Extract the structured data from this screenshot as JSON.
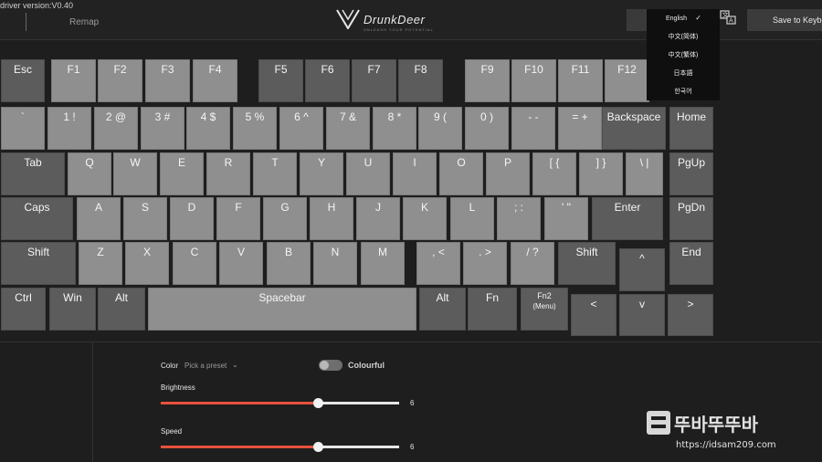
{
  "header": {
    "version": "driver version:V0.40",
    "remap_label": "Remap",
    "logo_text": "DrunkDeer",
    "tagline": "UNLEASH YOUR POTENTIAL",
    "save_label": "Save to Keyboard"
  },
  "language_menu": {
    "selected": "English",
    "items": [
      "English",
      "中文(简体)",
      "中文(繁体)",
      "日本語",
      "한국어"
    ]
  },
  "keyboard": {
    "rows": [
      [
        {
          "name": "key-esc",
          "label": "Esc",
          "tone": "dark"
        },
        {
          "name": "key-f1",
          "label": "F1",
          "tone": "light"
        },
        {
          "name": "key-f2",
          "label": "F2",
          "tone": "light"
        },
        {
          "name": "key-f3",
          "label": "F3",
          "tone": "light"
        },
        {
          "name": "key-f4",
          "label": "F4",
          "tone": "light"
        },
        {
          "name": "key-f5",
          "label": "F5",
          "tone": "dark"
        },
        {
          "name": "key-f6",
          "label": "F6",
          "tone": "dark"
        },
        {
          "name": "key-f7",
          "label": "F7",
          "tone": "dark"
        },
        {
          "name": "key-f8",
          "label": "F8",
          "tone": "dark"
        },
        {
          "name": "key-f9",
          "label": "F9",
          "tone": "light"
        },
        {
          "name": "key-f10",
          "label": "F10",
          "tone": "light"
        },
        {
          "name": "key-f11",
          "label": "F11",
          "tone": "light"
        },
        {
          "name": "key-f12",
          "label": "F12",
          "tone": "light"
        }
      ],
      [
        {
          "name": "key-backtick",
          "label": "`",
          "tone": "light"
        },
        {
          "name": "key-1",
          "label": "1 !",
          "tone": "light"
        },
        {
          "name": "key-2",
          "label": "2 @",
          "tone": "light"
        },
        {
          "name": "key-3",
          "label": "3 #",
          "tone": "light"
        },
        {
          "name": "key-4",
          "label": "4 $",
          "tone": "light"
        },
        {
          "name": "key-5",
          "label": "5 %",
          "tone": "light"
        },
        {
          "name": "key-6",
          "label": "6 ^",
          "tone": "light"
        },
        {
          "name": "key-7",
          "label": "7 &",
          "tone": "light"
        },
        {
          "name": "key-8",
          "label": "8 *",
          "tone": "light"
        },
        {
          "name": "key-9",
          "label": "9 (",
          "tone": "light"
        },
        {
          "name": "key-0",
          "label": "0 )",
          "tone": "light"
        },
        {
          "name": "key-minus",
          "label": "- -",
          "tone": "light"
        },
        {
          "name": "key-equal",
          "label": "= +",
          "tone": "light"
        },
        {
          "name": "key-backspace",
          "label": "Backspace",
          "tone": "dark"
        },
        {
          "name": "key-home",
          "label": "Home",
          "tone": "dark"
        }
      ],
      [
        {
          "name": "key-tab",
          "label": "Tab",
          "tone": "dark"
        },
        {
          "name": "key-q",
          "label": "Q",
          "tone": "light"
        },
        {
          "name": "key-w",
          "label": "W",
          "tone": "light"
        },
        {
          "name": "key-e",
          "label": "E",
          "tone": "light"
        },
        {
          "name": "key-r",
          "label": "R",
          "tone": "light"
        },
        {
          "name": "key-t",
          "label": "T",
          "tone": "light"
        },
        {
          "name": "key-y",
          "label": "Y",
          "tone": "light"
        },
        {
          "name": "key-u",
          "label": "U",
          "tone": "light"
        },
        {
          "name": "key-i",
          "label": "I",
          "tone": "light"
        },
        {
          "name": "key-o",
          "label": "O",
          "tone": "light"
        },
        {
          "name": "key-p",
          "label": "P",
          "tone": "light"
        },
        {
          "name": "key-lbracket",
          "label": "[ {",
          "tone": "light"
        },
        {
          "name": "key-rbracket",
          "label": "] }",
          "tone": "light"
        },
        {
          "name": "key-backslash",
          "label": "\\ |",
          "tone": "light"
        },
        {
          "name": "key-pgup",
          "label": "PgUp",
          "tone": "dark"
        }
      ],
      [
        {
          "name": "key-caps",
          "label": "Caps",
          "tone": "dark"
        },
        {
          "name": "key-a",
          "label": "A",
          "tone": "light"
        },
        {
          "name": "key-s",
          "label": "S",
          "tone": "light"
        },
        {
          "name": "key-d",
          "label": "D",
          "tone": "light"
        },
        {
          "name": "key-f",
          "label": "F",
          "tone": "light"
        },
        {
          "name": "key-g",
          "label": "G",
          "tone": "light"
        },
        {
          "name": "key-h",
          "label": "H",
          "tone": "light"
        },
        {
          "name": "key-j",
          "label": "J",
          "tone": "light"
        },
        {
          "name": "key-k",
          "label": "K",
          "tone": "light"
        },
        {
          "name": "key-l",
          "label": "L",
          "tone": "light"
        },
        {
          "name": "key-semicolon",
          "label": "; :",
          "tone": "light"
        },
        {
          "name": "key-quote",
          "label": "' \"",
          "tone": "light"
        },
        {
          "name": "key-enter",
          "label": "Enter",
          "tone": "dark"
        },
        {
          "name": "key-pgdn",
          "label": "PgDn",
          "tone": "dark"
        }
      ],
      [
        {
          "name": "key-lshift",
          "label": "Shift",
          "tone": "dark"
        },
        {
          "name": "key-z",
          "label": "Z",
          "tone": "light"
        },
        {
          "name": "key-x",
          "label": "X",
          "tone": "light"
        },
        {
          "name": "key-c",
          "label": "C",
          "tone": "light"
        },
        {
          "name": "key-v",
          "label": "V",
          "tone": "light"
        },
        {
          "name": "key-b",
          "label": "B",
          "tone": "light"
        },
        {
          "name": "key-n",
          "label": "N",
          "tone": "light"
        },
        {
          "name": "key-m",
          "label": "M",
          "tone": "light"
        },
        {
          "name": "key-comma",
          "label": ", <",
          "tone": "light"
        },
        {
          "name": "key-period",
          "label": ". >",
          "tone": "light"
        },
        {
          "name": "key-slash",
          "label": "/ ?",
          "tone": "light"
        },
        {
          "name": "key-rshift",
          "label": "Shift",
          "tone": "dark"
        },
        {
          "name": "key-up",
          "label": "^",
          "tone": "dark"
        },
        {
          "name": "key-end",
          "label": "End",
          "tone": "dark"
        }
      ],
      [
        {
          "name": "key-lctrl",
          "label": "Ctrl",
          "tone": "dark"
        },
        {
          "name": "key-win",
          "label": "Win",
          "tone": "dark"
        },
        {
          "name": "key-lalt",
          "label": "Alt",
          "tone": "dark"
        },
        {
          "name": "key-space",
          "label": "Spacebar",
          "tone": "light"
        },
        {
          "name": "key-ralt",
          "label": "Alt",
          "tone": "dark"
        },
        {
          "name": "key-fn",
          "label": "Fn",
          "tone": "dark"
        },
        {
          "name": "key-fn2",
          "label": "Fn2",
          "sub": "(Menu)",
          "tone": "dark"
        },
        {
          "name": "key-left",
          "label": "<",
          "tone": "dark"
        },
        {
          "name": "key-down",
          "label": "v",
          "tone": "dark"
        },
        {
          "name": "key-right",
          "label": ">",
          "tone": "dark"
        }
      ]
    ]
  },
  "lighting": {
    "color_label": "Color",
    "preset_placeholder": "Pick a preset",
    "mode_label": "Colourful",
    "mode_on": false,
    "brightness_label": "Brightness",
    "brightness_value": "6",
    "brightness_fraction": 0.66,
    "speed_label": "Speed",
    "speed_value": "6",
    "speed_fraction": 0.66,
    "accent_color": "#e8523c"
  },
  "watermark": {
    "logo_text": "뚜바뚜뚜바",
    "url": "https://idsam209.com"
  }
}
